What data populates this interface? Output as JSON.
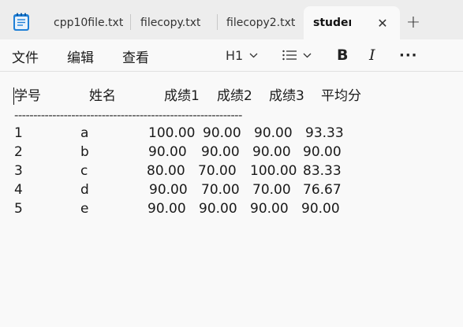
{
  "tabs": [
    {
      "label": "cpp10file.txt",
      "active": false
    },
    {
      "label": "filecopy.txt",
      "active": false
    },
    {
      "label": "filecopy2.txt",
      "active": false
    },
    {
      "label": "student",
      "active": true
    }
  ],
  "tab_close_symbol": "✕",
  "new_tab_symbol": "+",
  "menu": {
    "file": "文件",
    "edit": "编辑",
    "view": "查看"
  },
  "toolbar": {
    "heading": "H1",
    "bold": "B",
    "italic": "I",
    "more": "···"
  },
  "document": {
    "header": [
      "学号",
      "姓名",
      "成绩1",
      "成绩2",
      "成绩3",
      "平均分"
    ],
    "divider": "------------------------------------------------------------",
    "rows": [
      [
        "1",
        "a",
        "100.00",
        "90.00",
        "90.00",
        "93.33"
      ],
      [
        "2",
        "b",
        "90.00",
        "90.00",
        "90.00",
        "90.00"
      ],
      [
        "3",
        "c",
        "80.00",
        "70.00",
        "100.00",
        "83.33"
      ],
      [
        "4",
        "d",
        "90.00",
        "70.00",
        "70.00",
        "76.67"
      ],
      [
        "5",
        "e",
        "90.00",
        "90.00",
        "90.00",
        "90.00"
      ]
    ]
  },
  "colors": {
    "tabbar_bg": "#ededed",
    "editor_bg": "#f9f9f9",
    "app_icon_blue": "#1f7fd6"
  },
  "icons": [
    "notepad-app-icon",
    "close-icon",
    "plus-icon",
    "chevron-down-icon",
    "list-icon"
  ]
}
